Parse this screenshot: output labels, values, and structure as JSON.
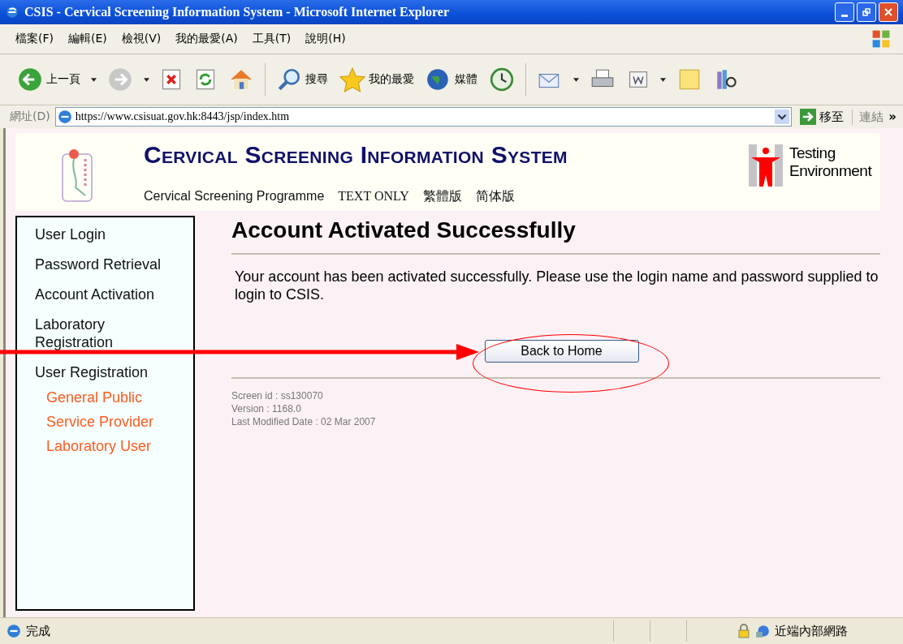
{
  "window": {
    "title": "CSIS - Cervical Screening Information System - Microsoft Internet Explorer"
  },
  "menu": [
    "檔案(F)",
    "編輯(E)",
    "檢視(V)",
    "我的最愛(A)",
    "工具(T)",
    "說明(H)"
  ],
  "toolbar": [
    {
      "kind": "back",
      "label": "上一頁"
    },
    {
      "kind": "forward"
    },
    {
      "kind": "stop"
    },
    {
      "kind": "refresh"
    },
    {
      "kind": "home"
    },
    {
      "kind": "search",
      "label": "搜尋"
    },
    {
      "kind": "favorites",
      "label": "我的最愛"
    },
    {
      "kind": "media",
      "label": "媒體"
    },
    {
      "kind": "history"
    },
    {
      "kind": "mail"
    },
    {
      "kind": "print"
    },
    {
      "kind": "edit"
    },
    {
      "kind": "note"
    },
    {
      "kind": "research"
    }
  ],
  "address": {
    "label": "網址(D)",
    "url": "https://www.csisuat.gov.hk:8443/jsp/index.htm",
    "go": "移至",
    "links": "連結",
    "more": "»"
  },
  "header": {
    "title": "Cervical Screening Information System",
    "links": [
      "Cervical Screening Programme",
      "TEXT ONLY",
      "繁體版",
      "简体版"
    ],
    "badge": "Testing Environment"
  },
  "sidebar": [
    {
      "label": "User Login"
    },
    {
      "label": "Password Retrieval"
    },
    {
      "label": "Account Activation"
    },
    {
      "label": "Laboratory Registration"
    },
    {
      "label": "User Registration",
      "children": [
        {
          "label": "General Public"
        },
        {
          "label": "Service Provider"
        },
        {
          "label": "Laboratory User"
        }
      ]
    }
  ],
  "content": {
    "heading": "Account Activated Successfully",
    "message": "Your account has been activated successfully. Please use the login name and password supplied to login to CSIS.",
    "button": "Back to Home",
    "footer": [
      "Screen id : ss130070",
      "Version : 1168.0",
      "Last Modified Date : 02 Mar 2007"
    ]
  },
  "status_bar": {
    "text": "完成",
    "zone": "近端內部網路"
  }
}
